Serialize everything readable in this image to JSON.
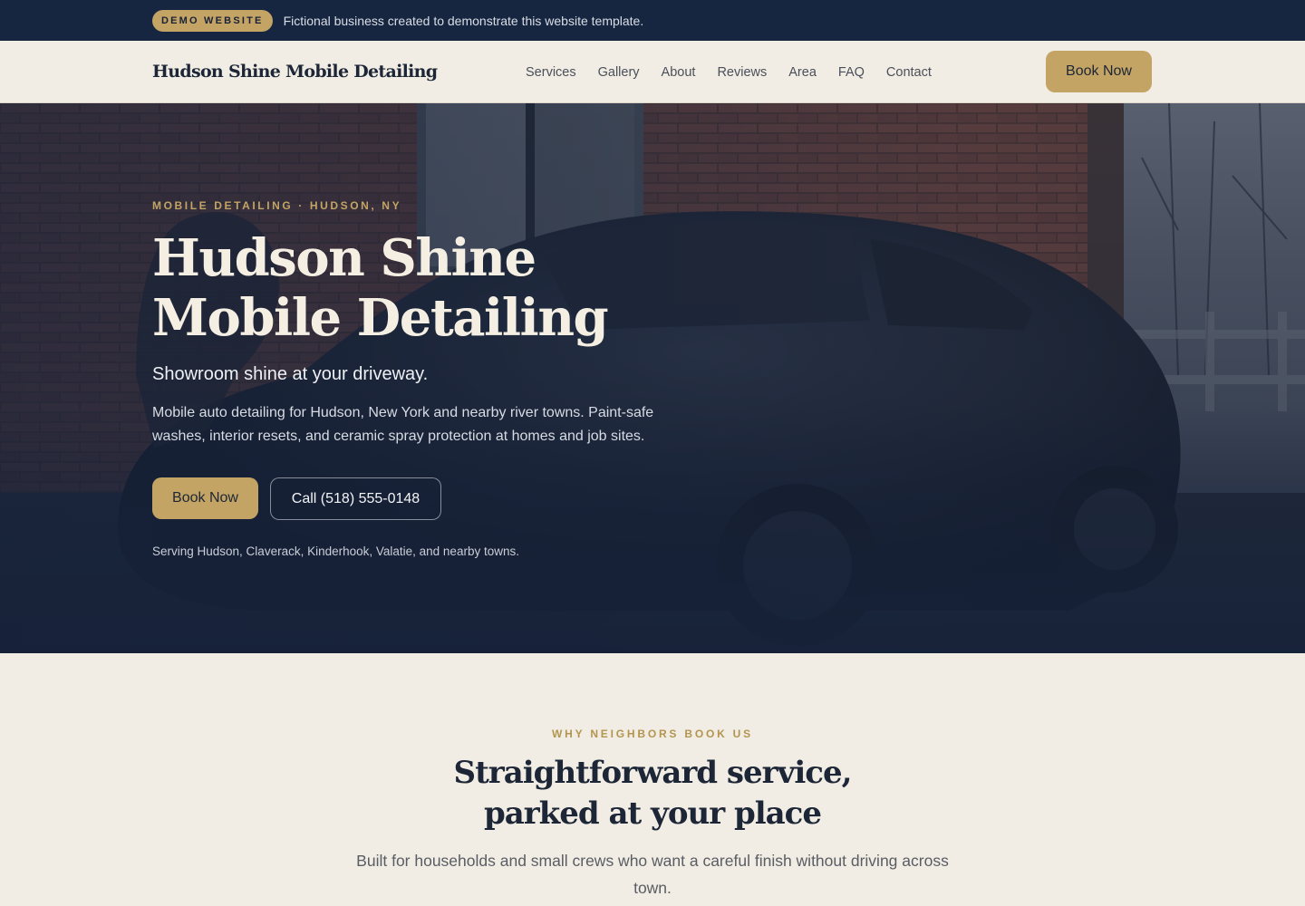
{
  "demo": {
    "badge": "DEMO WEBSITE",
    "text": "Fictional business created to demonstrate this website template."
  },
  "header": {
    "brand": "Hudson Shine Mobile Detailing",
    "nav": [
      "Services",
      "Gallery",
      "About",
      "Reviews",
      "Area",
      "FAQ",
      "Contact"
    ],
    "cta": "Book Now"
  },
  "hero": {
    "eyebrow": "MOBILE DETAILING · HUDSON, NY",
    "title_line1": "Hudson Shine",
    "title_line2": "Mobile Detailing",
    "subtitle": "Showroom shine at your driveway.",
    "description": "Mobile auto detailing for Hudson, New York and nearby river towns. Paint-safe washes, interior resets, and ceramic spray protection at homes and job sites.",
    "primary_cta": "Book Now",
    "secondary_cta": "Call (518) 555-0148",
    "service_area": "Serving Hudson, Claverack, Kinderhook, Valatie, and nearby towns."
  },
  "why": {
    "eyebrow": "WHY NEIGHBORS BOOK US",
    "title_line1": "Straightforward service,",
    "title_line2": "parked at your place",
    "description": "Built for households and small crews who want a careful finish without driving across town."
  },
  "colors": {
    "navy": "#172640",
    "gold": "#c3a464",
    "cream": "#f1ede4"
  }
}
